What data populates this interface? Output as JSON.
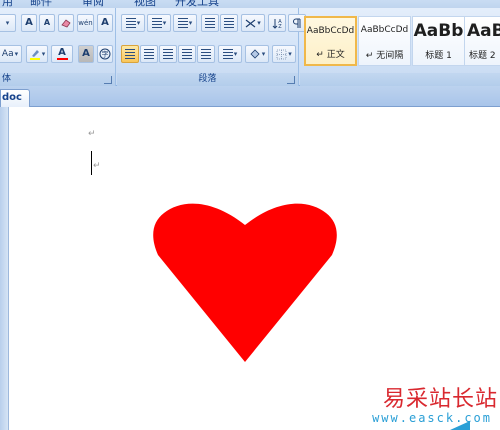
{
  "menubar": {
    "tabs": [
      "用",
      "邮件",
      "审阅",
      "视图",
      "开发工具"
    ]
  },
  "font_group": {
    "label": "体",
    "grow_label": "A",
    "shrink_label": "A",
    "phonetic_label": "wén",
    "char_shade_label": "A",
    "change_case_label": "Aa",
    "font_color_label": "A",
    "char_border_label": "A"
  },
  "paragraph_group": {
    "label": "段落"
  },
  "styles_group": {
    "items": [
      {
        "sample": "AaBbCcDd",
        "name": "↵ 正文",
        "selected": true
      },
      {
        "sample": "AaBbCcDd",
        "name": "↵ 无间隔",
        "selected": false
      },
      {
        "sample": "AaBb",
        "name": "标题 1",
        "selected": false
      },
      {
        "sample": "AaBb",
        "name": "标题 2",
        "selected": false
      }
    ]
  },
  "document_tab": {
    "label": "doc *"
  },
  "document": {
    "paragraph_mark": "↵",
    "heart_color": "#ff0000"
  },
  "watermark": {
    "text": "易采站长站",
    "url": "www.easck.com",
    "text_color": "#d9282f",
    "url_color": "#2a9fd6"
  }
}
